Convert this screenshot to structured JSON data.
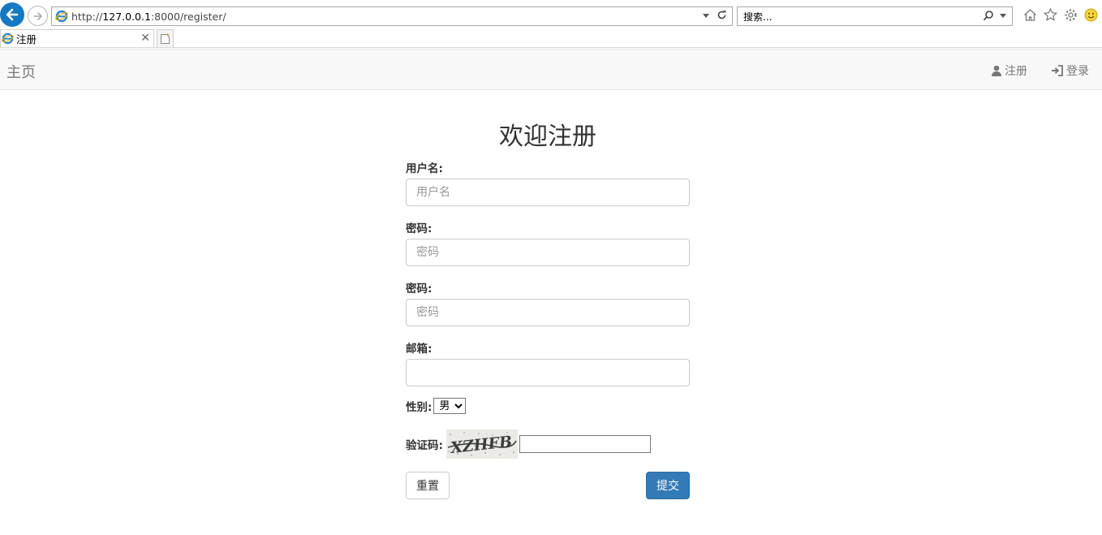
{
  "browser": {
    "url_prefix": "http://",
    "url_host": "127.0.0.1",
    "url_rest": ":8000/register/",
    "search_placeholder": "搜索...",
    "tab_title": "注册",
    "accent_color": "#1479c5"
  },
  "navbar": {
    "brand": "主页",
    "links": [
      {
        "label": "注册",
        "icon": "user-icon"
      },
      {
        "label": "登录",
        "icon": "log-in-icon"
      }
    ]
  },
  "form": {
    "title": "欢迎注册",
    "username_label": "用户名:",
    "username_placeholder": "用户名",
    "password_label": "密码:",
    "password_placeholder": "密码",
    "password2_label": "密码:",
    "password2_placeholder": "密码",
    "email_label": "邮箱:",
    "email_value": "",
    "gender_label": "性别:",
    "gender_selected": "男",
    "captcha_label": "验证码:",
    "captcha_text": "XZHFB",
    "captcha_value": "",
    "reset_label": "重置",
    "submit_label": "提交",
    "primary_color": "#337ab7"
  }
}
